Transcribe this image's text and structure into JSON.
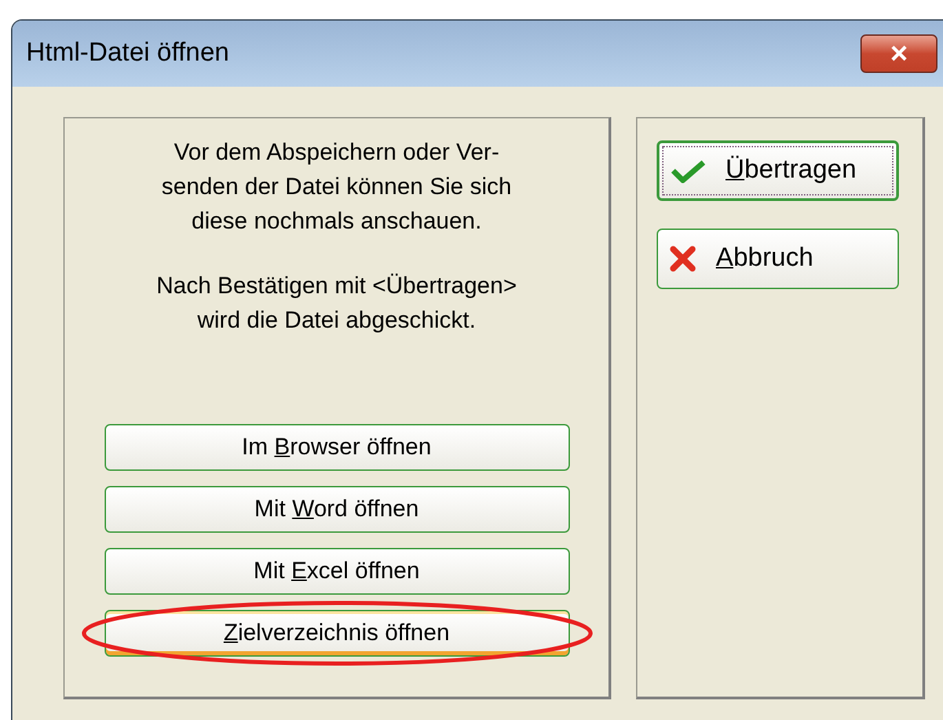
{
  "window": {
    "title": "Html-Datei öffnen",
    "close_button": "×"
  },
  "message": {
    "paragraphs": [
      "Vor dem Abspeichern oder Ver-\nsenden der Datei können Sie sich\ndiese nochmals anschauen.",
      "Nach Bestätigen mit <Übertragen>\nwird die Datei abgeschickt."
    ]
  },
  "open_buttons": [
    {
      "label": {
        "before": "Im ",
        "key": "B",
        "after": "rowser öffnen"
      },
      "hovered": false,
      "circled": false
    },
    {
      "label": {
        "before": "Mit ",
        "key": "W",
        "after": "ord öffnen"
      },
      "hovered": false,
      "circled": false
    },
    {
      "label": {
        "before": "Mit ",
        "key": "E",
        "after": "xcel öffnen"
      },
      "hovered": false,
      "circled": false
    },
    {
      "label": {
        "key": "Z",
        "after": "ielverzeichnis öffnen"
      },
      "hovered": true,
      "circled": true
    }
  ],
  "action_buttons": [
    {
      "kind": "confirm",
      "label": {
        "key": "Ü",
        "after": "bertragen"
      },
      "focused": true
    },
    {
      "kind": "cancel",
      "label": {
        "key": "A",
        "after": "bbruch"
      },
      "focused": false
    }
  ]
}
